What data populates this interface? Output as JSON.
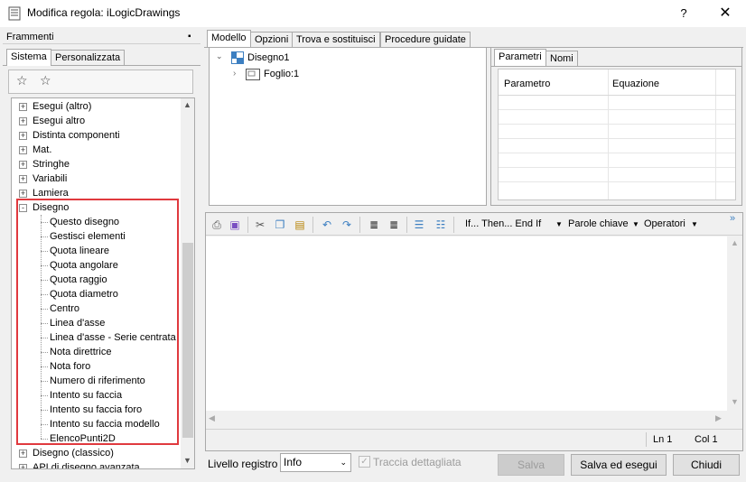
{
  "window": {
    "title": "Modifica regola: iLogicDrawings",
    "help": "?",
    "close": "✕"
  },
  "snippets_pane": {
    "title": "Frammenti",
    "tabs": [
      "Sistema",
      "Personalizzata"
    ],
    "tree": [
      {
        "label": "Esegui (altro)",
        "level": 0,
        "expander": "+"
      },
      {
        "label": "Esegui altro",
        "level": 0,
        "expander": "+"
      },
      {
        "label": "Distinta componenti",
        "level": 0,
        "expander": "+"
      },
      {
        "label": "Mat.",
        "level": 0,
        "expander": "+"
      },
      {
        "label": "Stringhe",
        "level": 0,
        "expander": "+"
      },
      {
        "label": "Variabili",
        "level": 0,
        "expander": "+"
      },
      {
        "label": "Lamiera",
        "level": 0,
        "expander": "+"
      },
      {
        "label": "Disegno",
        "level": 0,
        "expander": "-"
      },
      {
        "label": "Questo disegno",
        "level": 1
      },
      {
        "label": "Gestisci elementi",
        "level": 1
      },
      {
        "label": "Quota lineare",
        "level": 1
      },
      {
        "label": "Quota angolare",
        "level": 1
      },
      {
        "label": "Quota raggio",
        "level": 1
      },
      {
        "label": "Quota diametro",
        "level": 1
      },
      {
        "label": "Centro",
        "level": 1
      },
      {
        "label": "Linea d'asse",
        "level": 1
      },
      {
        "label": "Linea d'asse - Serie centrata",
        "level": 1
      },
      {
        "label": "Nota direttrice",
        "level": 1
      },
      {
        "label": "Nota foro",
        "level": 1
      },
      {
        "label": "Numero di riferimento",
        "level": 1
      },
      {
        "label": "Intento su faccia",
        "level": 1
      },
      {
        "label": "Intento su faccia foro",
        "level": 1
      },
      {
        "label": "Intento su faccia modello",
        "level": 1
      },
      {
        "label": "ElencoPunti2D",
        "level": 1
      },
      {
        "label": "Disegno (classico)",
        "level": 0,
        "expander": "+"
      },
      {
        "label": "API di disegno avanzata",
        "level": 0,
        "expander": "+"
      }
    ]
  },
  "main_tabs": [
    "Modello",
    "Opzioni",
    "Trova e sostituisci",
    "Procedure guidate"
  ],
  "model_tree": {
    "root": "Disegno1",
    "child": "Foglio:1"
  },
  "params_tabs": [
    "Parametri",
    "Nomi"
  ],
  "params_columns": [
    "Parametro",
    "Equazione"
  ],
  "editor_toolbar": {
    "menu_if": "If... Then... End If",
    "menu_keywords": "Parole chiave",
    "menu_operators": "Operatori",
    "overflow": "»"
  },
  "status": {
    "line": "Ln 1",
    "col": "Col 1"
  },
  "bottom": {
    "level_label": "Livello registro",
    "level_value": "Info",
    "trace_label": "Traccia dettagliata",
    "save": "Salva",
    "save_run": "Salva ed esegui",
    "close": "Chiudi"
  },
  "colors": {
    "highlight": "#e0393e",
    "accent": "#3c7fc1"
  }
}
